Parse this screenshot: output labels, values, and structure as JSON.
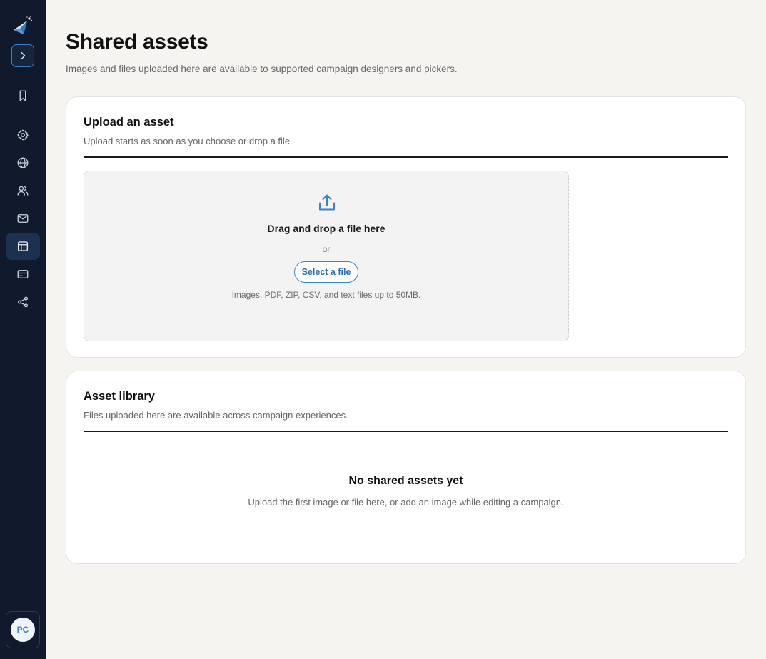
{
  "sidebar": {
    "items": [
      {
        "icon": "bookmark-icon",
        "active": false
      },
      {
        "icon": "gear-icon",
        "active": false
      },
      {
        "icon": "globe-icon",
        "active": false
      },
      {
        "icon": "users-icon",
        "active": false
      },
      {
        "icon": "mail-icon",
        "active": false
      },
      {
        "icon": "layout-icon",
        "active": true
      },
      {
        "icon": "credit-card-icon",
        "active": false
      },
      {
        "icon": "share-icon",
        "active": false
      }
    ],
    "avatar_initials": "PC"
  },
  "page": {
    "title": "Shared assets",
    "subtitle": "Images and files uploaded here are available to supported campaign designers and pickers."
  },
  "upload": {
    "title": "Upload an asset",
    "description": "Upload starts as soon as you choose or drop a file.",
    "dropzone_title": "Drag and drop a file here",
    "or_label": "or",
    "select_button": "Select a file",
    "hint": "Images, PDF, ZIP, CSV, and text files up to 50MB."
  },
  "library": {
    "title": "Asset library",
    "description": "Files uploaded here are available across campaign experiences.",
    "empty_title": "No shared assets yet",
    "empty_description": "Upload the first image or file here, or add an image while editing a campaign."
  },
  "colors": {
    "sidebar_bg": "#101a2c",
    "accent": "#3c82c8",
    "page_bg": "#f5f4f1"
  }
}
